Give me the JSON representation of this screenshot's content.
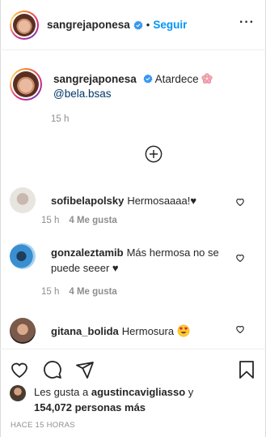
{
  "header": {
    "username": "sangrejaponesa",
    "dot": "•",
    "follow_label": "Seguir",
    "more_icon": "more-options-icon"
  },
  "caption": {
    "username": "sangrejaponesa",
    "text": "Atardece",
    "emoji": "cherry-blossom-icon",
    "mention": "@bela.bsas",
    "time": "15 h"
  },
  "comments": [
    {
      "username": "sofibelapolsky",
      "text": "Hermosaaaa!♥",
      "time": "15 h",
      "likes": "4 Me gusta",
      "avatar_color": "#d8d3cf"
    },
    {
      "username": "gonzaleztamib",
      "text": "Más hermosa no se puede seeer ♥",
      "time": "15 h",
      "likes": "4 Me gusta",
      "avatar_color": "#3a8fd0"
    },
    {
      "username": "gitana_bolida",
      "text": "Hermosura",
      "avatar_color": "#7a5a4a"
    }
  ],
  "actions": {
    "like_icon": "heart-icon",
    "comment_icon": "comment-icon",
    "share_icon": "send-icon",
    "save_icon": "bookmark-icon"
  },
  "likes": {
    "prefix": "Les gusta a",
    "user": "agustincavigliasso",
    "connector": "y",
    "count": "154,072 personas más"
  },
  "post_time": "HACE 15 HORAS",
  "colors": {
    "accent": "#0095f6",
    "mention": "#00376b",
    "muted": "#8e8e8e",
    "text": "#262626"
  }
}
